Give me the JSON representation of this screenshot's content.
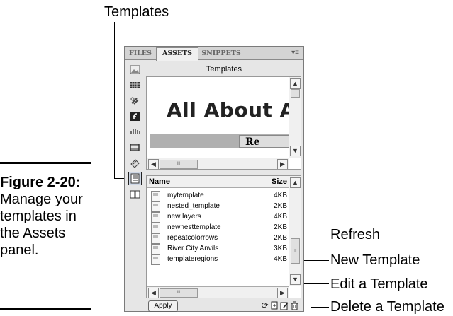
{
  "callouts": {
    "templates": "Templates",
    "refresh": "Refresh",
    "new_template": "New Template",
    "edit_template": "Edit a Template",
    "delete_template": "Delete a Template"
  },
  "caption": {
    "label": "Figure 2-20:",
    "text": "Manage your templates in the Assets panel."
  },
  "panel": {
    "tabs": [
      "FILES",
      "ASSETS",
      "SNIPPETS"
    ],
    "active_tab": "ASSETS",
    "header": "Templates",
    "preview": {
      "title": "All About Ar",
      "tag": "Re"
    },
    "columns": {
      "name": "Name",
      "size": "Size"
    },
    "rows": [
      {
        "name": "mytemplate",
        "size": "4KB"
      },
      {
        "name": "nested_template",
        "size": "2KB"
      },
      {
        "name": "new layers",
        "size": "4KB"
      },
      {
        "name": "newnesttemplate",
        "size": "2KB"
      },
      {
        "name": "repeatcolorrows",
        "size": "2KB"
      },
      {
        "name": "River City Anvils",
        "size": "3KB"
      },
      {
        "name": "templateregions",
        "size": "4KB"
      }
    ],
    "apply_label": "Apply",
    "scroll_thumb": "III",
    "category_icons": [
      "images-icon",
      "colors-icon",
      "urls-icon",
      "flash-icon",
      "shockwave-icon",
      "movies-icon",
      "scripts-icon",
      "templates-icon",
      "library-icon"
    ]
  }
}
